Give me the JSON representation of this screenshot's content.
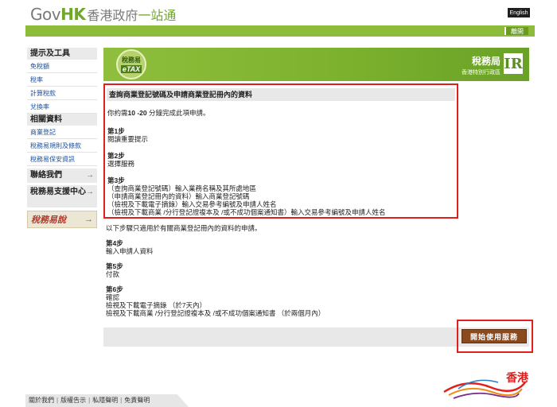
{
  "header": {
    "logo_gov": "Gov",
    "logo_hk": "HK",
    "logo_cn_a": "香港政府",
    "logo_cn_b": "一站通",
    "lang_button": "English",
    "logout_button": "離開"
  },
  "sidebar": {
    "section1": "提示及工具",
    "links1": [
      "免稅額",
      "稅率",
      "計算稅款",
      "兌換率"
    ],
    "section2": "相關資料",
    "links2": [
      "商業登記",
      "稅務易規則及條款",
      "稅務易保安資訊"
    ],
    "contact": "聯絡我們",
    "support": "稅務易支援中心",
    "banner": "稅務易說",
    "arrow": "→"
  },
  "banner": {
    "etax_top": "稅務易",
    "etax_bottom": "eTAX",
    "ird_name": "稅務局",
    "ird_region": "香港特別行政區",
    "ird_mark": "IR"
  },
  "info": {
    "title": "查詢商業登記號碼及申請商業登記冊內的資料",
    "intro_prefix": "你約需",
    "intro_time": "10 -20",
    "intro_suffix": " 分鐘完成此項申請。",
    "step1": "第1步",
    "step1_text": "閱讀重要提示",
    "step2": "第2步",
    "step2_text": "選擇服務",
    "step3": "第3步",
    "step3_lines": [
      "（查詢商業登記號碼）輸入業務名稱及其所處地區",
      "（申請商業登記冊內的資料）輸入商業登記號碼",
      "（檢視及下載電子摘錄）輸入交易參考編號及申請人姓名",
      "（檢視及下載商業 /分行登記證複本及 /或不成功個案通知書）輸入交易參考編號及申請人姓名"
    ]
  },
  "more": {
    "note": "以下步驟只適用於有關商業登記冊內的資料的申請。",
    "step4": "第4步",
    "step4_text": "輸入申請人資料",
    "step5": "第5步",
    "step5_text": "付款",
    "step6": "第6步",
    "step6_lines": [
      "確認",
      "檢視及下載電子摘錄 （於7天內）",
      "檢視及下載商業 /分行登記證複本及 /或不成功個案通知書 （於兩個月內）"
    ]
  },
  "start_button": "開始使用服務",
  "footer": {
    "links": [
      "關於我們",
      "版權告示",
      "私隱聲明",
      "免責聲明"
    ],
    "separator": "|"
  },
  "brand": {
    "text": "香港"
  },
  "colors": {
    "accent_green": "#8dbb3a",
    "highlight_red": "#e0201e",
    "start_button": "#8a4a1e"
  }
}
